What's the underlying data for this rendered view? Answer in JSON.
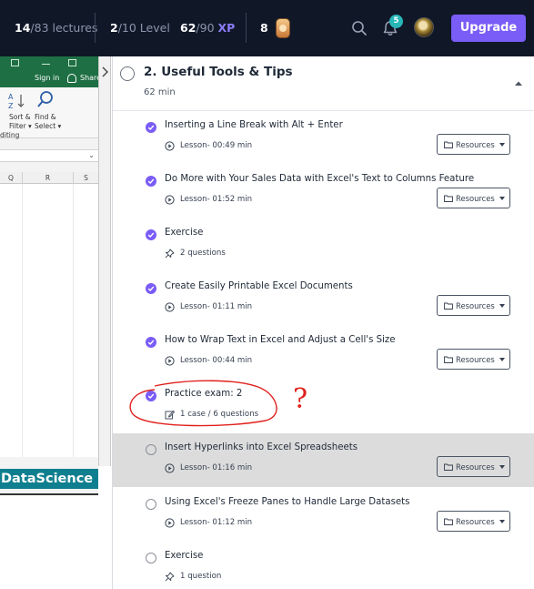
{
  "topbar": {
    "lectures_done": "14",
    "lectures_total": "/83 lectures",
    "level_current": "2",
    "level_total": "/10 Level",
    "xp_current": "62",
    "xp_total": "/90",
    "xp_label": "XP",
    "coins": "8",
    "notifications": "5",
    "upgrade_label": "Upgrade"
  },
  "excel": {
    "signin": "Sign in",
    "share": "Share",
    "sort_filter_1": "Sort &",
    "sort_filter_2": "Filter ▾",
    "find_select_1": "Find &",
    "find_select_2": "Select ▾",
    "editing": "diting",
    "columns": [
      "Q",
      "R",
      "S"
    ],
    "banner": "DataScience"
  },
  "section": {
    "title": "2. Useful Tools & Tips",
    "duration": "62 min"
  },
  "resources_label": "Resources",
  "items": [
    {
      "title": "Inserting a Line Break with Alt + Enter",
      "meta": "Lesson- 00:49 min",
      "meta_icon": "play-circle-icon",
      "done": true,
      "resources": true
    },
    {
      "title": "Do More with Your Sales Data with Excel's Text to Columns Feature",
      "meta": "Lesson- 01:52 min",
      "meta_icon": "play-circle-icon",
      "done": true,
      "resources": true
    },
    {
      "title": "Exercise",
      "meta": "2 questions",
      "meta_icon": "pin-icon",
      "done": true,
      "resources": false
    },
    {
      "title": "Create Easily Printable Excel Documents",
      "meta": "Lesson- 01:11 min",
      "meta_icon": "play-circle-icon",
      "done": true,
      "resources": true
    },
    {
      "title": "How to Wrap Text in Excel and Adjust a Cell's Size",
      "meta": "Lesson- 00:44 min",
      "meta_icon": "play-circle-icon",
      "done": true,
      "resources": true
    },
    {
      "title": "Practice exam: 2",
      "meta": "1 case / 6 questions",
      "meta_icon": "edit-icon",
      "done": true,
      "resources": false
    },
    {
      "title": "Insert Hyperlinks into Excel Spreadsheets",
      "meta": "Lesson- 01:16 min",
      "meta_icon": "play-circle-icon",
      "done": false,
      "resources": true,
      "active": true
    },
    {
      "title": "Using Excel's Freeze Panes to Handle Large Datasets",
      "meta": "Lesson- 01:12 min",
      "meta_icon": "play-circle-icon",
      "done": false,
      "resources": true
    },
    {
      "title": "Exercise",
      "meta": "1 question",
      "meta_icon": "pin-icon",
      "done": false,
      "resources": false
    }
  ],
  "annotation": {
    "mark": "?",
    "color": "#e0201c"
  }
}
